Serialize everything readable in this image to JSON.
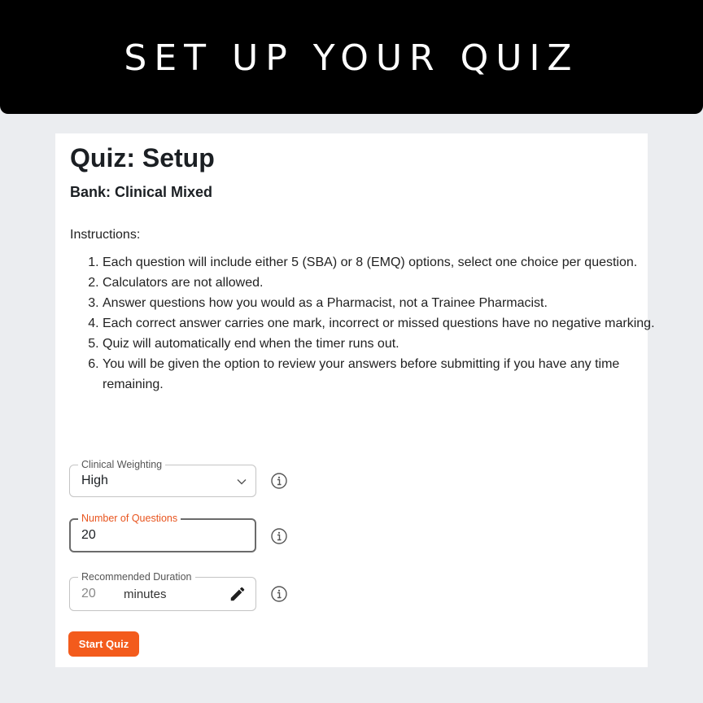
{
  "banner": {
    "title": "SET UP YOUR QUIZ"
  },
  "quiz": {
    "title": "Quiz: Setup",
    "bank": "Bank: Clinical Mixed",
    "instructions_heading": "Instructions:",
    "instructions": [
      "Each question will include either 5 (SBA) or 8 (EMQ) options, select one choice per question.",
      "Calculators are not allowed.",
      "Answer questions how you would as a Pharmacist, not a Trainee Pharmacist.",
      "Each correct answer carries one mark, incorrect or missed questions have no negative marking.",
      "Quiz will automatically end when the timer runs out.",
      "You will be given the option to review your answers before submitting if you have any time remaining."
    ]
  },
  "form": {
    "weighting": {
      "label": "Clinical Weighting",
      "value": "High"
    },
    "questions": {
      "label": "Number of Questions",
      "value": "20"
    },
    "duration": {
      "label": "Recommended Duration",
      "value": "20",
      "unit": "minutes"
    },
    "start_label": "Start Quiz"
  },
  "colors": {
    "accent": "#f35b1c",
    "active_label": "#e8541e",
    "banner_bg": "#000000"
  },
  "icons": [
    "info-icon",
    "chevron-down-icon",
    "pencil-icon"
  ]
}
